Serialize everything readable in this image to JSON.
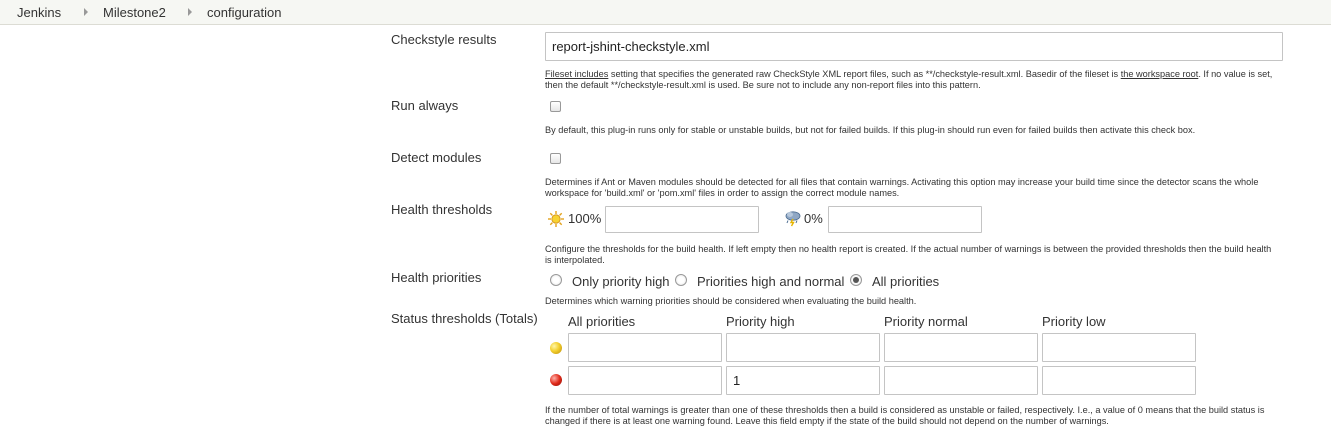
{
  "breadcrumb": {
    "items": [
      "Jenkins",
      "Milestone2",
      "configuration"
    ]
  },
  "checkstyle": {
    "label": "Checkstyle results",
    "value": "report-jshint-checkstyle.xml",
    "desc_link1": "Fileset includes",
    "desc_part1": " setting that specifies the generated raw CheckStyle XML report files, such as **/checkstyle-result.xml. Basedir of the fileset is ",
    "desc_link2": "the workspace root",
    "desc_part2": ". If no value is set, then the default **/checkstyle-result.xml is used. Be sure not to include any non-report files into this pattern."
  },
  "run_always": {
    "label": "Run always",
    "checked": false,
    "desc": "By default, this plug-in runs only for stable or unstable builds, but not for failed builds. If this plug-in should run even for failed builds then activate this check box."
  },
  "detect_modules": {
    "label": "Detect modules",
    "checked": false,
    "desc": "Determines if Ant or Maven modules should be detected for all files that contain warnings. Activating this option may increase your build time since the detector scans the whole workspace for 'build.xml' or 'pom.xml' files in order to assign the correct module names."
  },
  "health_thresholds": {
    "label": "Health thresholds",
    "sunny_label": "100%",
    "sunny_icon": "sunny-weather-icon",
    "sunny_value": "",
    "stormy_label": "0%",
    "stormy_icon": "stormy-weather-icon",
    "stormy_value": "",
    "desc": "Configure the thresholds for the build health. If left empty then no health report is created. If the actual number of warnings is between the provided thresholds then the build health is interpolated."
  },
  "health_priorities": {
    "label": "Health priorities",
    "options": [
      "Only priority high",
      "Priorities high and normal",
      "All priorities"
    ],
    "selected": "All priorities",
    "desc": "Determines which warning priorities should be considered when evaluating the build health."
  },
  "status_thresholds": {
    "label": "Status thresholds (Totals)",
    "columns": [
      "All priorities",
      "Priority high",
      "Priority normal",
      "Priority low"
    ],
    "unstable_icon": "yellow-ball-icon",
    "failed_icon": "red-ball-icon",
    "unstable_values": [
      "",
      "",
      "",
      ""
    ],
    "failed_values": [
      "",
      "1",
      "",
      ""
    ],
    "desc": "If the number of total warnings is greater than one of these thresholds then a build is considered as unstable or failed, respectively. I.e., a value of 0 means that the build status is changed if there is at least one warning found. Leave this field empty if the state of the build should not depend on the number of warnings."
  },
  "colors": {
    "breadcrumb_bg": "#f6f7f3",
    "input_border": "#c4c4c4",
    "text": "#333333"
  }
}
